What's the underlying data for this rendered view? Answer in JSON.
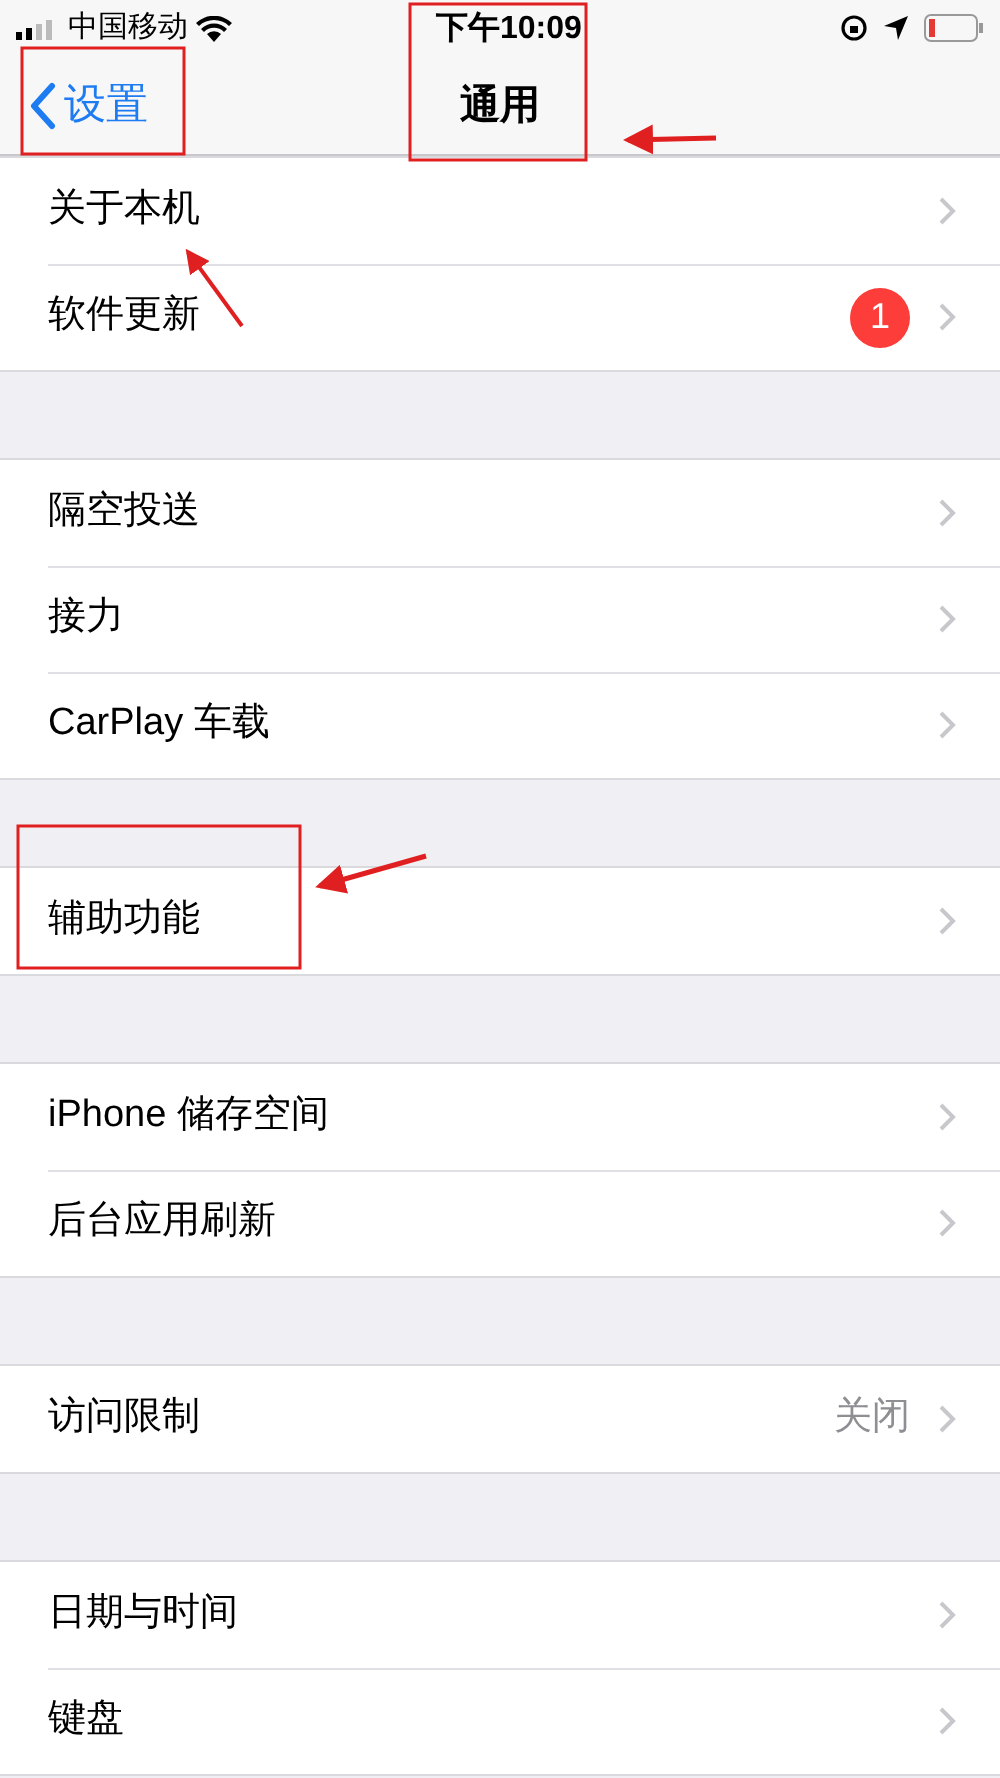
{
  "status_bar": {
    "carrier": "中国移动",
    "time": "下午10:09"
  },
  "nav_bar": {
    "back_label": "设置",
    "title": "通用"
  },
  "sections": [
    {
      "rows": [
        {
          "label": "关于本机"
        },
        {
          "label": "软件更新",
          "badge": "1"
        }
      ]
    },
    {
      "rows": [
        {
          "label": "隔空投送"
        },
        {
          "label": "接力"
        },
        {
          "label": "CarPlay 车载"
        }
      ]
    },
    {
      "rows": [
        {
          "label": "辅助功能"
        }
      ]
    },
    {
      "rows": [
        {
          "label": "iPhone 储存空间"
        },
        {
          "label": "后台应用刷新"
        }
      ]
    },
    {
      "rows": [
        {
          "label": "访问限制",
          "value": "关闭"
        }
      ]
    },
    {
      "rows": [
        {
          "label": "日期与时间"
        },
        {
          "label": "键盘"
        }
      ]
    }
  ]
}
